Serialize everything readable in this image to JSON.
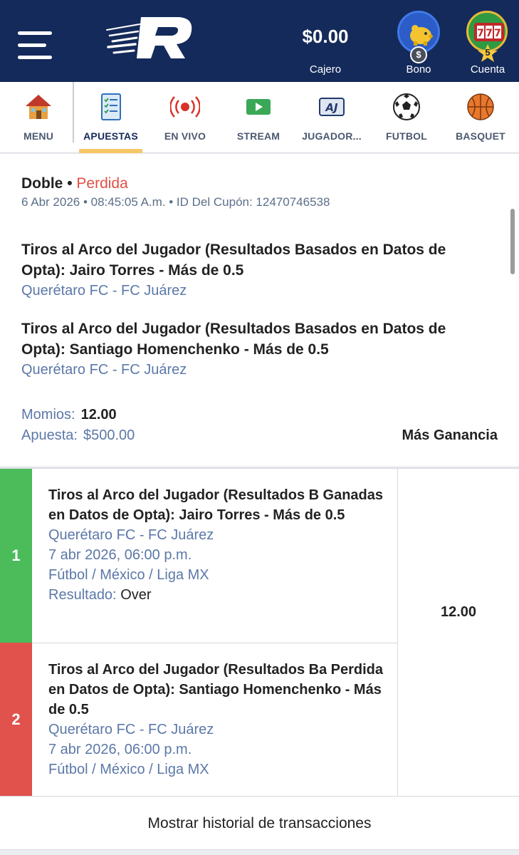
{
  "header": {
    "balance": "$0.00",
    "cashier_label": "Cajero",
    "bonus_label": "Bono",
    "bonus_coin": "$",
    "account_label": "Cuenta",
    "account_level": "5",
    "colors": {
      "bar": "#142a5a",
      "accent": "#f6c766"
    }
  },
  "nav": {
    "items": [
      {
        "label": "MENU",
        "icon": "house-icon"
      },
      {
        "label": "APUESTAS",
        "icon": "betslip-icon"
      },
      {
        "label": "EN VIVO",
        "icon": "live-broadcast-icon"
      },
      {
        "label": "STREAM",
        "icon": "play-video-icon"
      },
      {
        "label": "JUGADOR...",
        "icon": "aj-player-icon"
      },
      {
        "label": "FUTBOL",
        "icon": "soccer-ball-icon"
      },
      {
        "label": "BASQUET",
        "icon": "basketball-icon"
      }
    ],
    "active": "APUESTAS"
  },
  "ticket": {
    "type": "Doble",
    "separator": "•",
    "status": "Perdida",
    "meta": "6 Abr 2026 • 08:45:05 A.m. • ID Del Cupón: 12470746538",
    "selections": [
      {
        "title": "Tiros al Arco del Jugador (Resultados Basados en Datos de Opta): Jairo Torres - Más de 0.5",
        "match": "Querétaro FC - FC Juárez"
      },
      {
        "title": "Tiros al Arco del Jugador (Resultados Basados en Datos de Opta): Santiago Homenchenko - Más de 0.5",
        "match": "Querétaro FC - FC Juárez"
      }
    ],
    "odds_label": "Momios:",
    "odds_value": "12.00",
    "stake_label": "Apuesta:",
    "stake_value": "$500.00",
    "extra_label": "Más Ganancia"
  },
  "legs": [
    {
      "number": "1",
      "status": "Ganadas",
      "color": "#4cbb5a",
      "title": "Tiros al Arco del Jugador (Resultados Basados en Datos de Opta): Jairo Torres - Más de 0.5",
      "match": "Querétaro FC - FC Juárez",
      "date": "7 abr 2026, 06:00 p.m.",
      "league": "Fútbol / México / Liga MX",
      "result_label": "Resultado:",
      "result_value": "Over"
    },
    {
      "number": "2",
      "status": "Perdida",
      "color": "#e0524b",
      "title": "Tiros al Arco del Jugador (Resultados Basados en Datos de Opta): Santiago Homenchenko - Más de 0.5",
      "match": "Querétaro FC - FC Juárez",
      "date": "7 abr 2026, 06:00 p.m.",
      "league": "Fútbol / México / Liga MX"
    }
  ],
  "total_odds": "12.00",
  "history_button": "Mostrar historial de transacciones"
}
